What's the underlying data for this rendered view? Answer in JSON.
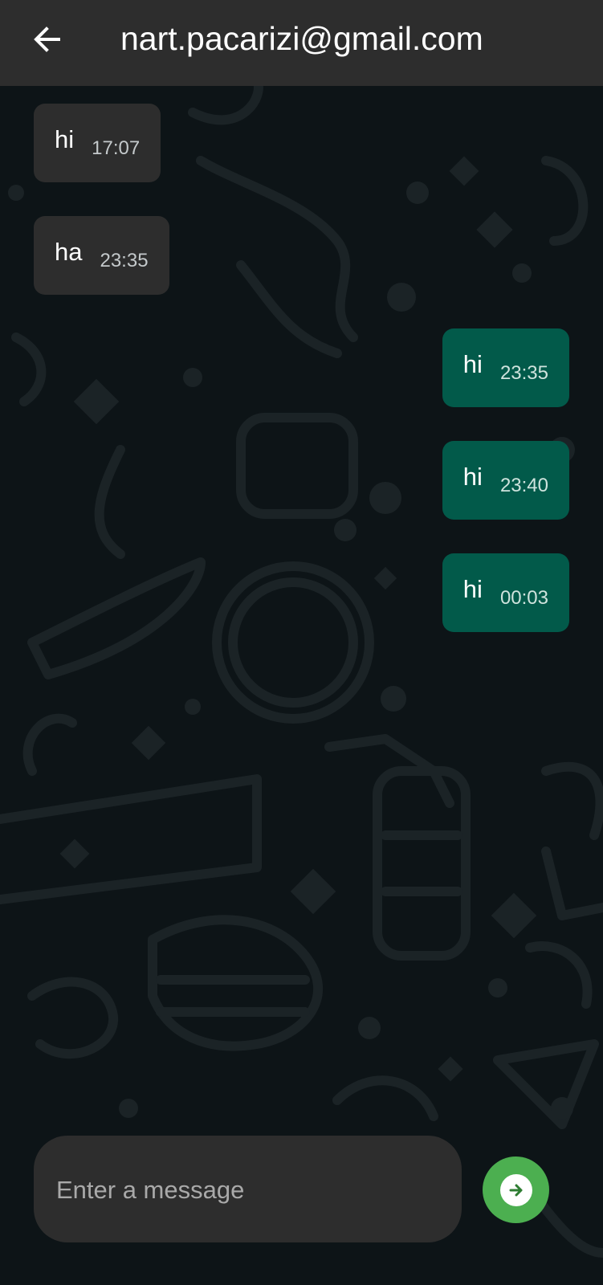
{
  "app_bar": {
    "title": "nart.pacarizi@gmail.com",
    "back_icon": "arrow-left-icon"
  },
  "messages": [
    {
      "text": "hi",
      "time": "17:07",
      "direction": "incoming"
    },
    {
      "text": "ha",
      "time": "23:35",
      "direction": "incoming"
    },
    {
      "text": "hi",
      "time": "23:35",
      "direction": "outgoing"
    },
    {
      "text": "hi",
      "time": "23:40",
      "direction": "outgoing"
    },
    {
      "text": "hi",
      "time": "00:03",
      "direction": "outgoing"
    }
  ],
  "composer": {
    "placeholder": "Enter a message",
    "value": "",
    "send_icon": "arrow-right-icon"
  },
  "colors": {
    "app_bar": "#2d2d2d",
    "background": "#0d1417",
    "incoming_bubble": "#2d2d2d",
    "outgoing_bubble": "#025a4a",
    "send_button": "#4caf50"
  }
}
